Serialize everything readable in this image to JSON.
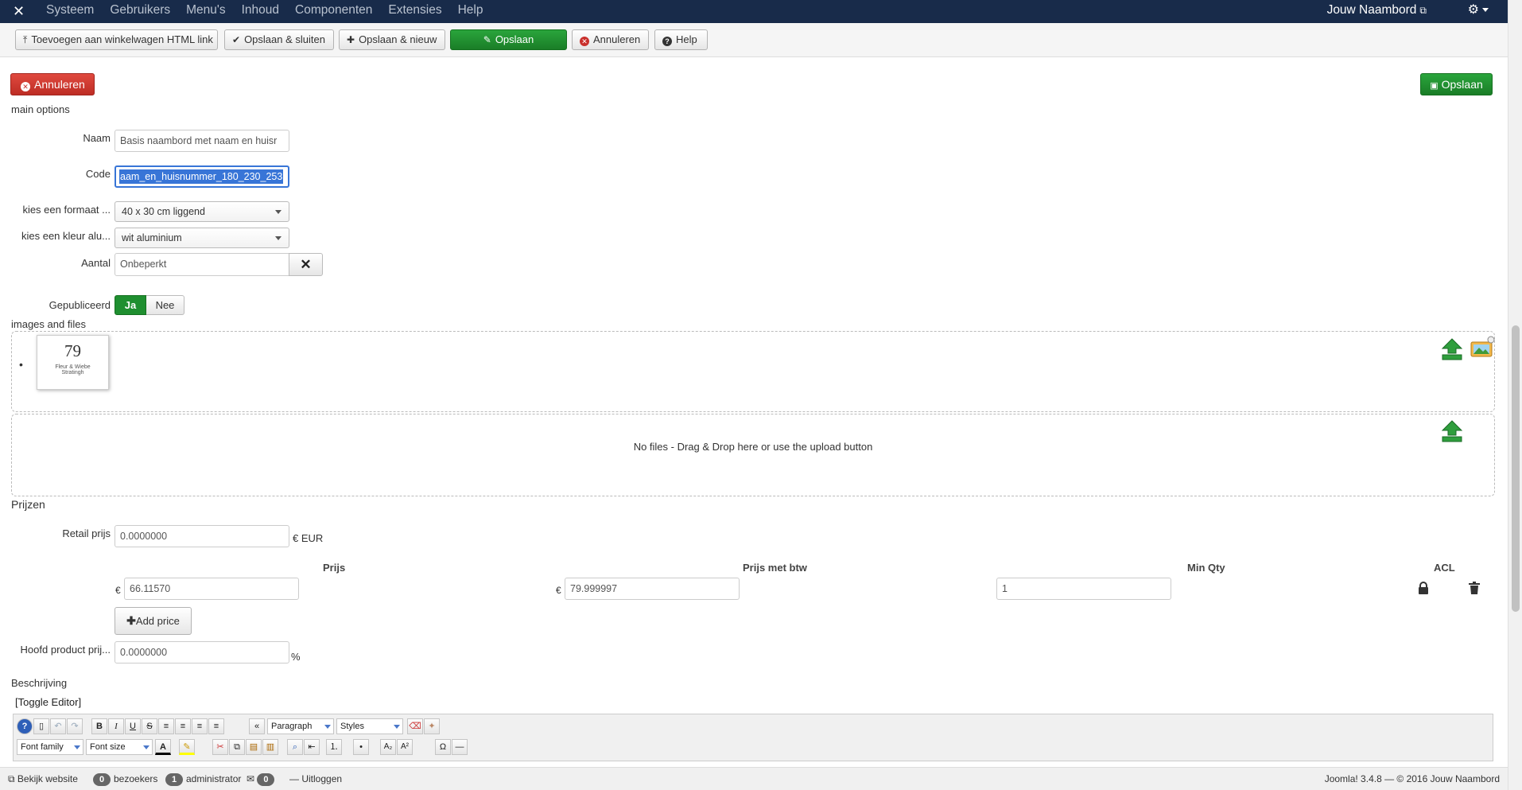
{
  "navbar": {
    "logo": "✕",
    "menu": [
      "Systeem",
      "Gebruikers",
      "Menu's",
      "Inhoud",
      "Componenten",
      "Extensies",
      "Help"
    ],
    "brand": "Jouw Naambord"
  },
  "toolbar": {
    "add_cart_label": "Toevoegen aan winkelwagen HTML link",
    "save_close_label": "Opslaan & sluiten",
    "save_new_label": "Opslaan & nieuw",
    "save_label": "Opslaan",
    "cancel_label": "Annuleren",
    "help_label": "Help"
  },
  "form": {
    "cancel_label": "Annuleren",
    "save_label": "Opslaan",
    "section_main": "main options",
    "name_label": "Naam",
    "name_value": "Basis naambord met naam en huisr",
    "code_label": "Code",
    "code_value": "aam_en_huisnummer_180_230_253",
    "format_label": "kies een formaat ...",
    "format_value": "40 x 30 cm liggend",
    "color_label": "kies een kleur alu...",
    "color_value": "wit aluminium",
    "quantity_label": "Aantal",
    "quantity_value": "Onbeperkt",
    "published_label": "Gepubliceerd",
    "published_yes": "Ja",
    "published_no": "Nee",
    "section_images": "images and files",
    "bullet": "•",
    "thumb_number": "79",
    "thumb_caption_1": "Fleur & Wiebe",
    "thumb_caption_2": "Stratingh",
    "no_files": "No files - Drag & Drop here or use the upload button",
    "section_prices": "Prijzen",
    "retail_label": "Retail prijs",
    "retail_value": "0.0000000",
    "retail_unit": "€ EUR",
    "col_price": "Prijs",
    "col_price_vat": "Prijs met btw",
    "col_min_qty": "Min Qty",
    "col_acl": "ACL",
    "currency": "€",
    "price_value": "66.11570",
    "price_vat_value": "79.999997",
    "min_qty_value": "1",
    "add_price_label": "Add price",
    "main_price_label": "Hoofd product prij...",
    "main_price_value": "0.0000000",
    "percent": "%",
    "description_label": "Beschrijving",
    "toggle_editor": "[Toggle Editor]"
  },
  "editor": {
    "format_select": "Paragraph",
    "styles_select": "Styles",
    "font_family_select": "Font family",
    "font_size_select": "Font size"
  },
  "statusbar": {
    "view_site": "Bekijk website",
    "visitors_count": "0",
    "visitors_label": "bezoekers",
    "admin_count": "1",
    "admin_label": "administrator",
    "messages_count": "0",
    "logout_label": "Uitloggen",
    "version": "Joomla! 3.4.8 — © 2016 Jouw Naambord"
  },
  "colors": {
    "navbar": "#182b4a",
    "primary_green": "#1f8f30",
    "danger_red": "#c9302c",
    "selection_blue": "#3875d7"
  }
}
